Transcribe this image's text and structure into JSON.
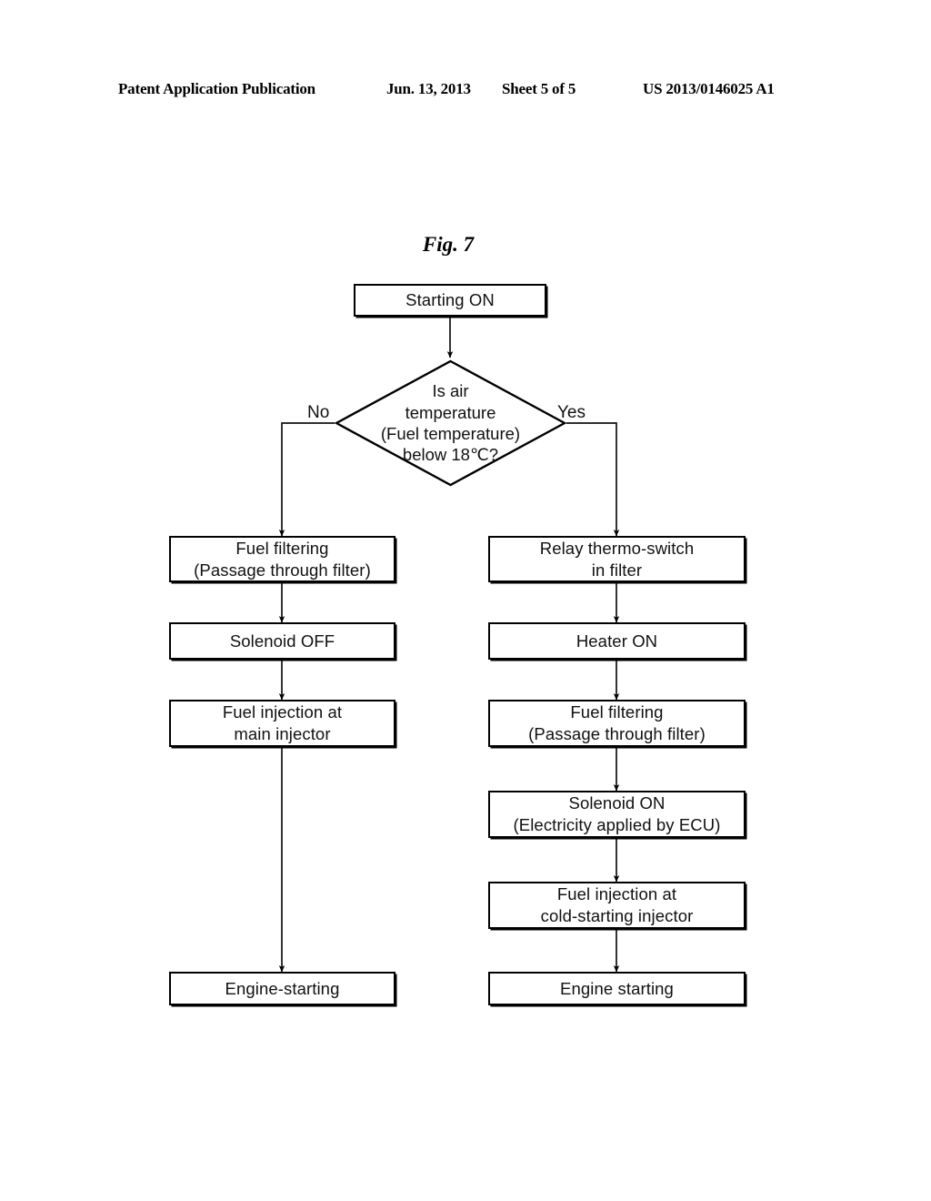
{
  "header": {
    "publication": "Patent Application Publication",
    "date": "Jun. 13, 2013",
    "sheet": "Sheet 5 of 5",
    "publication_number": "US 2013/0146025 A1"
  },
  "figure": {
    "title": "Fig. 7"
  },
  "diagram": {
    "type": "flowchart",
    "start": {
      "label": "Starting ON"
    },
    "decision": {
      "lines": [
        "Is air",
        "temperature",
        "(Fuel temperature)",
        "below 18℃?"
      ],
      "branch_no": "No",
      "branch_yes": "Yes"
    },
    "left_branch": [
      {
        "lines": [
          "Fuel filtering",
          "(Passage through filter)"
        ]
      },
      {
        "lines": [
          "Solenoid OFF"
        ]
      },
      {
        "lines": [
          "Fuel injection at",
          "main injector"
        ]
      },
      {
        "lines": [
          "Engine-starting"
        ]
      }
    ],
    "right_branch": [
      {
        "lines": [
          "Relay thermo-switch",
          "in filter"
        ]
      },
      {
        "lines": [
          "Heater ON"
        ]
      },
      {
        "lines": [
          "Fuel filtering",
          "(Passage through filter)"
        ]
      },
      {
        "lines": [
          "Solenoid ON",
          "(Electricity applied by ECU)"
        ]
      },
      {
        "lines": [
          "Fuel injection at",
          "cold-starting injector"
        ]
      },
      {
        "lines": [
          "Engine starting"
        ]
      }
    ],
    "colors": {
      "stroke": "#000000",
      "background": "#ffffff",
      "text": "#111111"
    }
  }
}
